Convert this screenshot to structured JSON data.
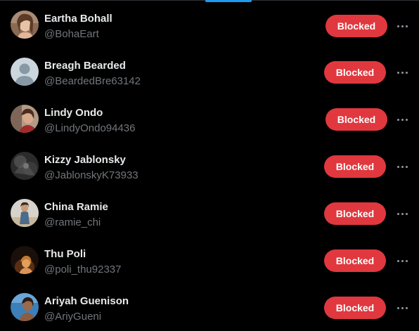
{
  "accent_color": "#1d9bf0",
  "blocked_color": "#e0383e",
  "users": [
    {
      "name": "Eartha Bohall",
      "handle": "@BohaEart",
      "button_label": "Blocked",
      "avatar_icon": "profile-photo"
    },
    {
      "name": "Breagh Bearded",
      "handle": "@BeardedBre63142",
      "button_label": "Blocked",
      "avatar_icon": "default-avatar"
    },
    {
      "name": "Lindy Ondo",
      "handle": "@LindyOndo94436",
      "button_label": "Blocked",
      "avatar_icon": "profile-photo"
    },
    {
      "name": "Kizzy Jablonsky",
      "handle": "@JablonskyK73933",
      "button_label": "Blocked",
      "avatar_icon": "profile-photo"
    },
    {
      "name": "China Ramie",
      "handle": "@ramie_chi",
      "button_label": "Blocked",
      "avatar_icon": "profile-photo"
    },
    {
      "name": "Thu Poli",
      "handle": "@poli_thu92337",
      "button_label": "Blocked",
      "avatar_icon": "profile-photo"
    },
    {
      "name": "Ariyah Guenison",
      "handle": "@AriyGueni",
      "button_label": "Blocked",
      "avatar_icon": "profile-photo"
    }
  ]
}
